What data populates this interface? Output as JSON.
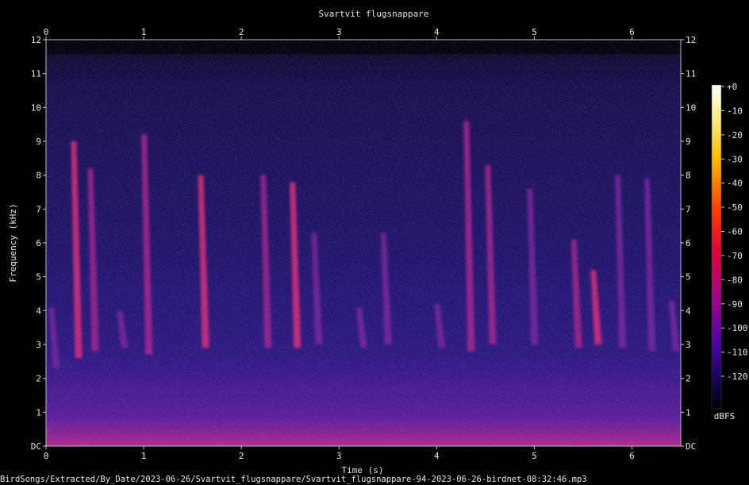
{
  "chart_data": {
    "type": "heatmap",
    "title": "Svartvit flugsnappare",
    "xlabel": "Time (s)",
    "ylabel": "Frequency (kHz)",
    "xlim": [
      0,
      6.5
    ],
    "ylim": [
      0,
      12
    ],
    "x_ticks": [
      "0",
      "1",
      "2",
      "3",
      "4",
      "5",
      "6"
    ],
    "y_ticks": [
      "DC",
      "1",
      "2",
      "3",
      "4",
      "5",
      "6",
      "7",
      "8",
      "9",
      "10",
      "11",
      "12"
    ],
    "colorbar": {
      "label": "dBFS",
      "range": [
        -120,
        0
      ],
      "ticks": [
        "+0",
        "-10",
        "-20",
        "-30",
        "-40",
        "-50",
        "-60",
        "-70",
        "-80",
        "-90",
        "-100",
        "-110",
        "-120"
      ]
    },
    "strokes": [
      {
        "t": 0.05,
        "f_top": 4.1,
        "f_bot": 2.3,
        "level": 0.35
      },
      {
        "t": 0.28,
        "f_top": 9.0,
        "f_bot": 2.6,
        "level": 0.75
      },
      {
        "t": 0.45,
        "f_top": 8.2,
        "f_bot": 2.8,
        "level": 0.55
      },
      {
        "t": 0.75,
        "f_top": 4.0,
        "f_bot": 2.9,
        "level": 0.45
      },
      {
        "t": 1.0,
        "f_top": 9.2,
        "f_bot": 2.7,
        "level": 0.7
      },
      {
        "t": 1.58,
        "f_top": 8.0,
        "f_bot": 2.9,
        "level": 0.75
      },
      {
        "t": 2.22,
        "f_top": 8.0,
        "f_bot": 2.9,
        "level": 0.55
      },
      {
        "t": 2.52,
        "f_top": 7.8,
        "f_bot": 2.9,
        "level": 0.8
      },
      {
        "t": 2.74,
        "f_top": 6.3,
        "f_bot": 3.0,
        "level": 0.5
      },
      {
        "t": 3.2,
        "f_top": 4.1,
        "f_bot": 2.9,
        "level": 0.4
      },
      {
        "t": 3.45,
        "f_top": 6.3,
        "f_bot": 3.0,
        "level": 0.5
      },
      {
        "t": 4.0,
        "f_top": 4.2,
        "f_bot": 2.9,
        "level": 0.45
      },
      {
        "t": 4.3,
        "f_top": 9.6,
        "f_bot": 2.8,
        "level": 0.7
      },
      {
        "t": 4.52,
        "f_top": 8.3,
        "f_bot": 3.0,
        "level": 0.6
      },
      {
        "t": 4.95,
        "f_top": 7.6,
        "f_bot": 3.0,
        "level": 0.5
      },
      {
        "t": 5.4,
        "f_top": 6.1,
        "f_bot": 2.9,
        "level": 0.6
      },
      {
        "t": 5.6,
        "f_top": 5.2,
        "f_bot": 3.0,
        "level": 0.75
      },
      {
        "t": 5.85,
        "f_top": 8.0,
        "f_bot": 2.9,
        "level": 0.5
      },
      {
        "t": 6.15,
        "f_top": 7.9,
        "f_bot": 2.8,
        "level": 0.5
      },
      {
        "t": 6.4,
        "f_top": 4.3,
        "f_bot": 2.8,
        "level": 0.45
      }
    ]
  },
  "footer": {
    "path": "BirdSongs/Extracted/By_Date/2023-06-26/Svartvit_flugsnappare/Svartvit_flugsnappare-94-2023-06-26-birdnet-08:32:46.mp3"
  }
}
